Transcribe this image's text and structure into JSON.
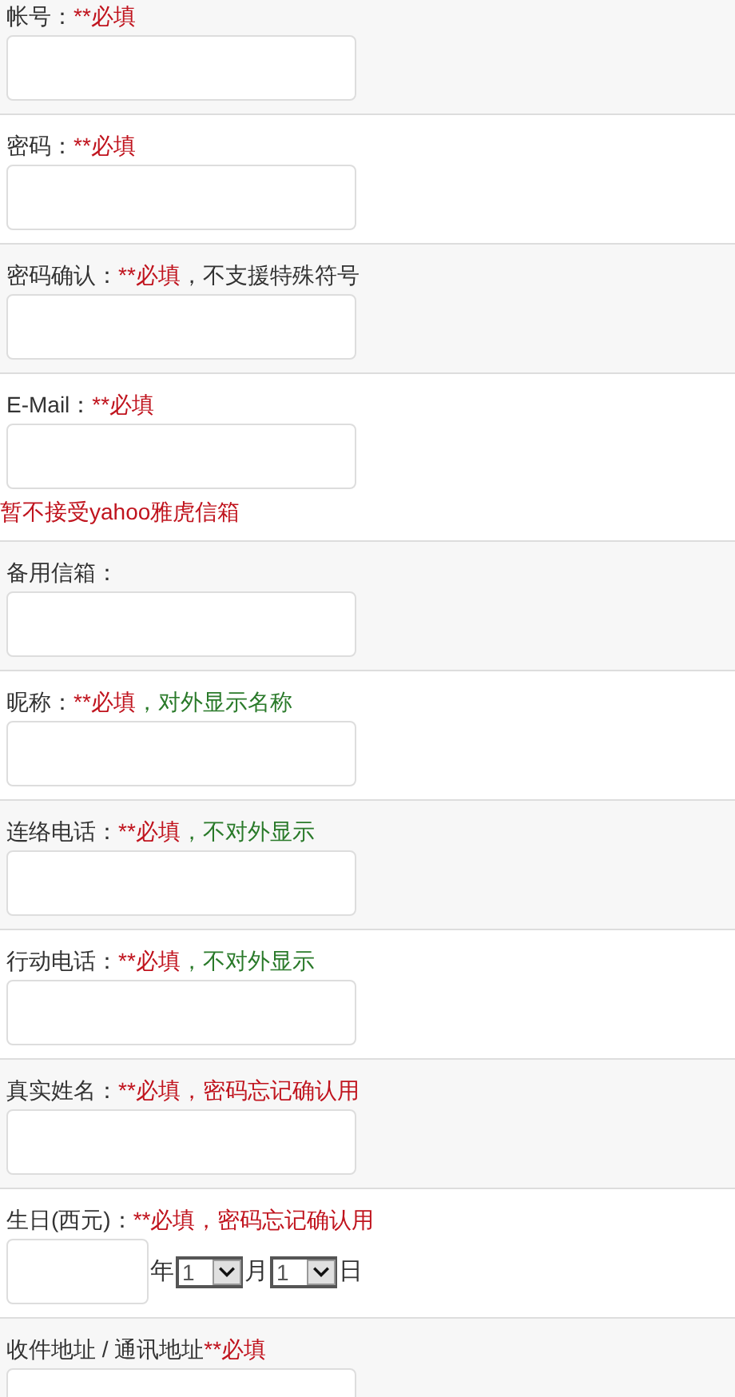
{
  "fields": [
    {
      "kind": "text",
      "label": [
        {
          "text": "帐号：",
          "color": "#333333"
        },
        {
          "text": "**必填",
          "color": "#c0141e"
        }
      ]
    },
    {
      "kind": "text",
      "label": [
        {
          "text": "密码：",
          "color": "#333333"
        },
        {
          "text": "**必填",
          "color": "#c0141e"
        }
      ]
    },
    {
      "kind": "text",
      "label": [
        {
          "text": "密码确认：",
          "color": "#333333"
        },
        {
          "text": "**必填",
          "color": "#c0141e"
        },
        {
          "text": "，不支援特殊符号",
          "color": "#333333"
        }
      ]
    },
    {
      "kind": "text",
      "label": [
        {
          "text": "E-Mail：",
          "color": "#333333"
        },
        {
          "text": "**必填",
          "color": "#c0141e"
        }
      ],
      "hint": "暂不接受yahoo雅虎信箱"
    },
    {
      "kind": "text",
      "label": [
        {
          "text": "备用信箱：",
          "color": "#333333"
        }
      ]
    },
    {
      "kind": "text",
      "label": [
        {
          "text": "昵称：",
          "color": "#333333"
        },
        {
          "text": "**必填",
          "color": "#c0141e"
        },
        {
          "text": "，对外显示名称",
          "color": "#2a7a2a"
        }
      ]
    },
    {
      "kind": "text",
      "label": [
        {
          "text": "连络电话：",
          "color": "#333333"
        },
        {
          "text": "**必填",
          "color": "#c0141e"
        },
        {
          "text": "，不对外显示",
          "color": "#2a7a2a"
        }
      ]
    },
    {
      "kind": "text",
      "label": [
        {
          "text": "行动电话：",
          "color": "#333333"
        },
        {
          "text": "**必填",
          "color": "#c0141e"
        },
        {
          "text": "，不对外显示",
          "color": "#2a7a2a"
        }
      ]
    },
    {
      "kind": "text",
      "label": [
        {
          "text": "真实姓名：",
          "color": "#333333"
        },
        {
          "text": "**必填",
          "color": "#c0141e"
        },
        {
          "text": "，密码忘记确认用",
          "color": "#c0141e"
        }
      ]
    },
    {
      "kind": "date",
      "label": [
        {
          "text": "生日(西元)：",
          "color": "#333333"
        },
        {
          "text": "**必填",
          "color": "#c0141e"
        },
        {
          "text": "，密码忘记确认用",
          "color": "#c0141e"
        }
      ],
      "year_unit": "年",
      "month": "1",
      "month_unit": "月",
      "day": "1",
      "day_unit": "日"
    },
    {
      "kind": "text",
      "label": [
        {
          "text": "收件地址 / 通讯地址",
          "color": "#333333"
        },
        {
          "text": "**必填",
          "color": "#c0141e"
        }
      ]
    }
  ]
}
